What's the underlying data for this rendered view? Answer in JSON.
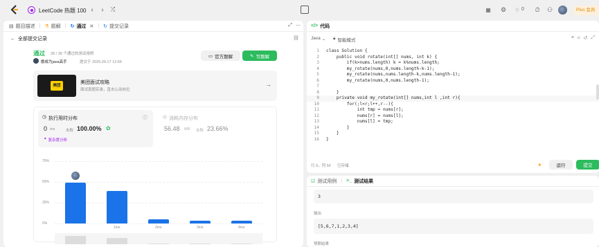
{
  "topbar": {
    "app_title": "LeetCode 热题 100",
    "counter": "0",
    "plus_label": "Plus 会员"
  },
  "left_tabs": [
    {
      "label": "题目描述"
    },
    {
      "label": "题解"
    },
    {
      "label": "通过"
    },
    {
      "label": "提交记录"
    }
  ],
  "back_label": "全部提交记录",
  "submission": {
    "status": "通过",
    "summary": "39 / 39 个通过的测试用例",
    "author": "憨成为java高手",
    "submitted_at": "提交于 2025.09.17 12:59",
    "official_btn": "官方题解",
    "write_btn": "写题解"
  },
  "promo": {
    "logo_text": "美团",
    "title": "美团面试攻略",
    "subtitle": "面试真题实录，直击心动岗位"
  },
  "runtime": {
    "title": "执行用时分布",
    "value": "0",
    "unit": "ms",
    "beat_label": "击败",
    "beat_pct": "100.00%",
    "analysis": "复杂度分析"
  },
  "memory": {
    "title": "消耗内存分布",
    "value": "56.48",
    "unit": "MB",
    "beat_label": "击败",
    "beat_pct": "23.66%"
  },
  "chart_data": {
    "type": "bar",
    "categories": [
      "0ms",
      "1ms",
      "2ms",
      "3ms",
      "4ms"
    ],
    "visible_tick_labels": [
      "1ms",
      "2ms",
      "3ms",
      "4ms"
    ],
    "values": [
      49,
      39,
      5,
      3,
      3
    ],
    "ylim": [
      0,
      75
    ],
    "yticks": [
      "75%",
      "50%",
      "25%",
      "0%"
    ],
    "highlight_index": 0,
    "bar_color": "#1a73e8"
  },
  "editor": {
    "tab_title": "代码",
    "language": "Java",
    "mode": "智能模式",
    "status_pos": "行 9，列 50",
    "status_saved": "已存储",
    "run_btn": "运行",
    "submit_btn": "提交",
    "lines": [
      {
        "n": "1",
        "t": "class Solution {"
      },
      {
        "n": "2",
        "t": "    public void rotate(int[] nums, int k) {"
      },
      {
        "n": "3",
        "t": "        if(k>nums.length) k = k%nums.length;"
      },
      {
        "n": "4",
        "t": "        my_rotate(nums,0,nums.length-k-1);"
      },
      {
        "n": "5",
        "t": "        my_rotate(nums,nums.length-k,nums.length-1);"
      },
      {
        "n": "6",
        "t": "        my_rotate(nums,0,nums.length-1);"
      },
      {
        "n": "7",
        "t": ""
      },
      {
        "n": "8",
        "t": "    }"
      },
      {
        "n": "9",
        "t": "    private void my_rotate(int[] nums,int l ,int r){"
      },
      {
        "n": "10",
        "t": "        for(;l<r;l++,r--){"
      },
      {
        "n": "11",
        "t": "            int tmp = nums[r];"
      },
      {
        "n": "12",
        "t": "            nums[r] = nums[l];"
      },
      {
        "n": "13",
        "t": "            nums[l] = tmp;"
      },
      {
        "n": "14",
        "t": "        }"
      },
      {
        "n": "15",
        "t": "    }"
      },
      {
        "n": "16",
        "t": "}"
      }
    ]
  },
  "result_panel": {
    "tab_cases": "测试用例",
    "tab_result": "测试结果",
    "input_value": "3",
    "output_label": "输出",
    "output_value": "[5,6,7,1,2,3,4]",
    "expected_label": "预期结果"
  }
}
